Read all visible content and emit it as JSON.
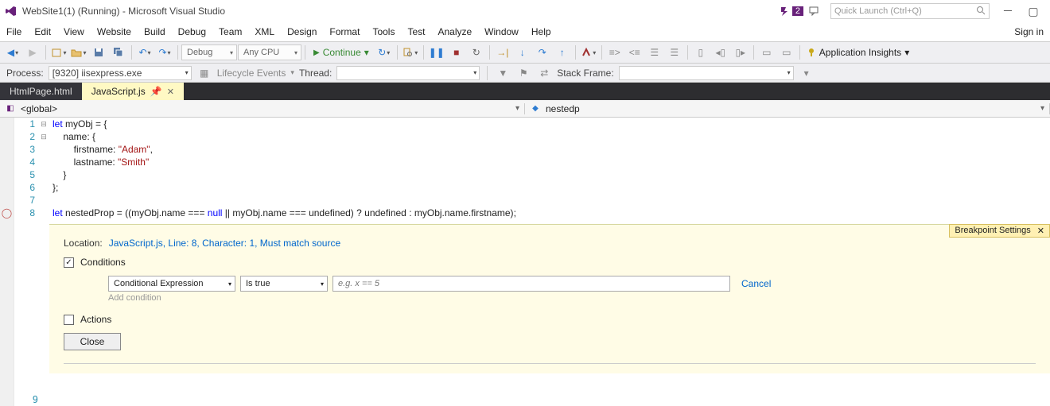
{
  "titlebar": {
    "title": "WebSite1(1) (Running) - Microsoft Visual Studio",
    "notif_count": "2",
    "quick_launch_placeholder": "Quick Launch (Ctrl+Q)",
    "sign_in": "Sign in"
  },
  "menu": [
    "File",
    "Edit",
    "View",
    "Website",
    "Build",
    "Debug",
    "Team",
    "XML",
    "Design",
    "Format",
    "Tools",
    "Test",
    "Analyze",
    "Window",
    "Help"
  ],
  "toolbar": {
    "config": "Debug",
    "platform": "Any CPU",
    "continue": "Continue",
    "app_insights": "Application Insights"
  },
  "debugbar": {
    "process_label": "Process:",
    "process_value": "[9320] iisexpress.exe",
    "lifecycle": "Lifecycle Events",
    "thread_label": "Thread:",
    "thread_value": "",
    "stack_label": "Stack Frame:",
    "stack_value": ""
  },
  "tabs": {
    "inactive": "HtmlPage.html",
    "active": "JavaScript.js"
  },
  "scope": {
    "left": "<global>",
    "right": "nestedp"
  },
  "code": {
    "l1a": "let",
    "l1b": " myObj = {",
    "l2": "    name: {",
    "l3a": "        firstname: ",
    "l3b": "\"Adam\"",
    "l3c": ",",
    "l4a": "        lastname: ",
    "l4b": "\"Smith\"",
    "l5": "    }",
    "l6": "};",
    "l7": "",
    "l8a": "let",
    "l8b": " nestedProp = ((myObj.name === ",
    "l8c": "null",
    "l8d": " || myObj.name === undefined) ? undefined : myObj.name.firstname)",
    "l8e": ";"
  },
  "linenums": [
    "1",
    "2",
    "3",
    "4",
    "5",
    "6",
    "7",
    "8",
    "9"
  ],
  "bp_panel": {
    "tag": "Breakpoint Settings",
    "tag_close": "✕",
    "loc_label": "Location:",
    "loc_link": "JavaScript.js, Line: 8, Character: 1, Must match source",
    "conditions": "Conditions",
    "cond_type": "Conditional Expression",
    "cond_op": "Is true",
    "cond_placeholder": "e.g. x == 5",
    "cancel": "Cancel",
    "add_condition": "Add condition",
    "actions": "Actions",
    "close": "Close"
  }
}
